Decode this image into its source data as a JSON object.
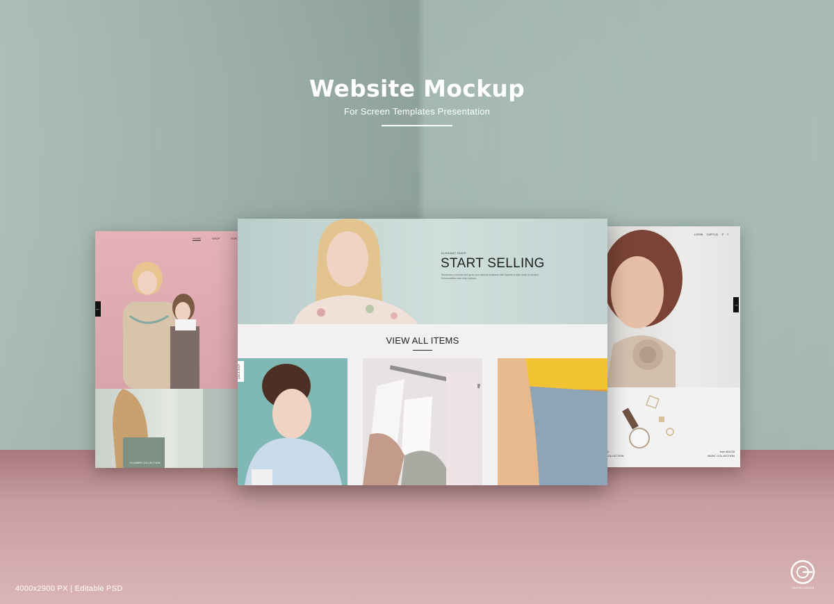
{
  "headline": {
    "title": "Website Mockup",
    "subtitle": "For Screen Templates Presentation"
  },
  "left_screen": {
    "nav": [
      "HOME",
      "SHOP",
      "FOR"
    ],
    "bottom_label": "FLOWER COLLECTION"
  },
  "center_screen": {
    "eyebrow": "ELEGANT SHOP",
    "title": "START SELLING",
    "body": "Showcase products and grow your fashion business with Byandr.a wide array of modern functionalities and shop options.",
    "section_heading": "VIEW ALL ITEMS",
    "quick_shop": "QUICK SHOP"
  },
  "right_screen": {
    "nav": [
      "LOGIN",
      "CART (0)"
    ],
    "price_left": "$0",
    "collection_left": "COLLECTION",
    "price_right": "from $19.00",
    "collection_right": "BASIC COLLECTION"
  },
  "footer": {
    "specs": "4000x2900 PX   |   Editable PSD",
    "logo_text": "GRAPHIC GOOGLE"
  },
  "colors": {
    "wall": "#a9bcb6",
    "floor": "#dbb5b6",
    "left_screen_bg": "#e8b7bb",
    "center_hero_bg": "#c8dad6",
    "accent_yellow": "#e2a03a"
  }
}
